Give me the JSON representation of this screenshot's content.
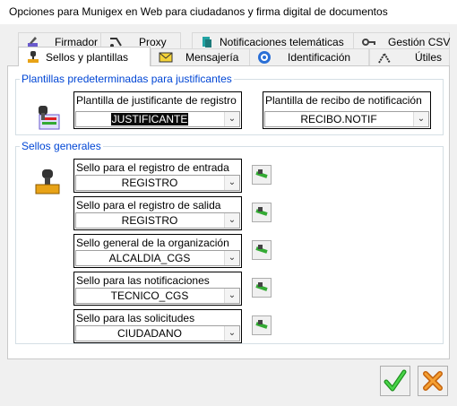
{
  "window": {
    "title": "Opciones para Munigex en Web para ciudadanos y firma digital de documentos"
  },
  "tabs_back": [
    {
      "label": "Firmador",
      "underline": "F",
      "icon": "pen-sign-icon"
    },
    {
      "label": "Proxy",
      "underline": "P",
      "icon": "proxy-icon"
    },
    {
      "label": "Notificaciones telemáticas",
      "underline": "N",
      "icon": "notification-icon"
    },
    {
      "label": "Gestión CSV",
      "underline": "G",
      "icon": "key-icon"
    }
  ],
  "tabs_front": [
    {
      "label": "Sellos y plantillas",
      "underline": "S",
      "icon": "stamp-icon",
      "active": true
    },
    {
      "label": "Mensajería",
      "underline": "M",
      "icon": "mail-icon",
      "active": false
    },
    {
      "label": "Identificación",
      "underline": "I",
      "icon": "id-icon",
      "active": false
    },
    {
      "label": "Útiles",
      "underline": "Ú",
      "icon": "tools-icon",
      "active": false
    }
  ],
  "templates": {
    "legend": "Plantillas predeterminadas para justificantes",
    "receipt_label": "Plantilla de justificante de registro",
    "receipt_value": "JUSTIFICANTE",
    "notif_label": "Plantilla de recibo de notificación",
    "notif_value": "RECIBO.NOTIF"
  },
  "seals": {
    "legend": "Sellos generales",
    "items": [
      {
        "label": "Sello para el registro de entrada",
        "value": "REGISTRO"
      },
      {
        "label": "Sello para el registro de salida",
        "value": "REGISTRO"
      },
      {
        "label": "Sello general de la organización",
        "value": "ALCALDIA_CGS"
      },
      {
        "label": "Sello para las notificaciones",
        "value": "TECNICO_CGS"
      },
      {
        "label": "Sello para las solicitudes",
        "value": "CIUDADANO"
      }
    ]
  },
  "buttons": {
    "accept_icon": "check-icon",
    "cancel_icon": "cancel-icon"
  },
  "colors": {
    "legend": "#0046d5",
    "accept": "#2bb02b",
    "cancel": "#f08a1c"
  }
}
